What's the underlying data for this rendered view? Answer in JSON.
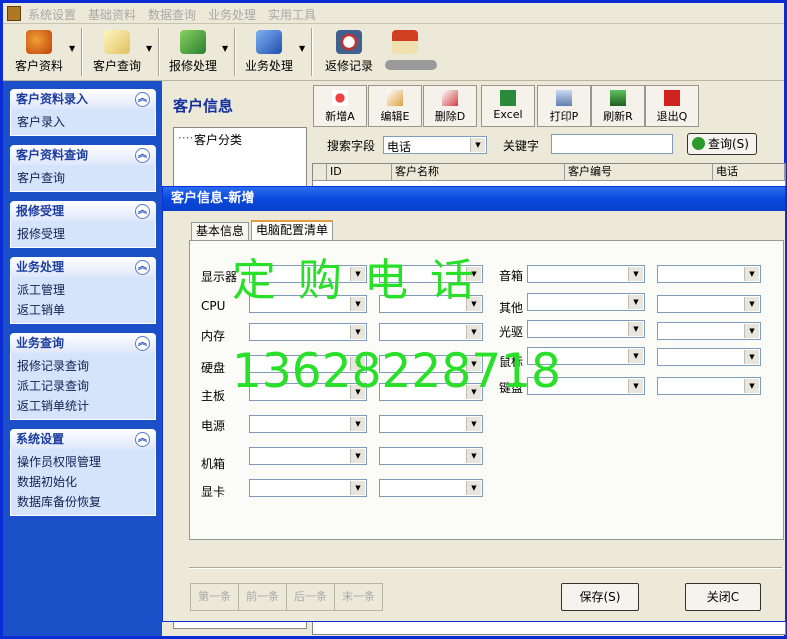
{
  "menubar": {
    "items": [
      "系统设置",
      "基础资料",
      "数据查询",
      "业务处理",
      "实用工具"
    ]
  },
  "toolbar": {
    "buttons": [
      "客户资料",
      "客户查询",
      "报修处理",
      "业务处理",
      "返修记录"
    ]
  },
  "sidebar": {
    "panels": [
      {
        "title": "客户资料录入",
        "items": [
          "客户录入"
        ]
      },
      {
        "title": "客户资料查询",
        "items": [
          "客户查询"
        ]
      },
      {
        "title": "报修受理",
        "items": [
          "报修受理"
        ]
      },
      {
        "title": "业务处理",
        "items": [
          "派工管理",
          "返工销单"
        ]
      },
      {
        "title": "业务查询",
        "items": [
          "报修记录查询",
          "派工记录查询",
          "返工销单统计"
        ]
      },
      {
        "title": "系统设置",
        "items": [
          "操作员权限管理",
          "数据初始化",
          "数据库备份恢复"
        ]
      }
    ]
  },
  "main": {
    "title": "客户信息",
    "buttons": [
      "新增A",
      "编辑E",
      "删除D",
      "Excel",
      "打印P",
      "刷新R",
      "退出Q"
    ],
    "tree_root": "客户分类",
    "search": {
      "field_label": "搜索字段",
      "field_value": "电话",
      "keyword_label": "关键字",
      "keyword_value": "",
      "query_button": "查询(S)"
    },
    "grid_headers": [
      "ID",
      "客户名称",
      "客户编号",
      "电话"
    ]
  },
  "dialog": {
    "title": "客户信息-新增",
    "tabs": [
      "基本信息",
      "电脑配置清单"
    ],
    "left_fields": [
      "显示器",
      "CPU",
      "内存",
      "硬盘",
      "主板",
      "电源",
      "机箱",
      "显卡"
    ],
    "right_fields": [
      "音箱",
      "其他",
      "光驱",
      "鼠标",
      "键盘"
    ],
    "nav_buttons": [
      "第一条",
      "前一条",
      "后一条",
      "末一条"
    ],
    "save_button": "保存(S)",
    "close_button": "关闭C"
  },
  "watermark": {
    "line1": "定 购 电 话",
    "line2": "13628228718"
  }
}
